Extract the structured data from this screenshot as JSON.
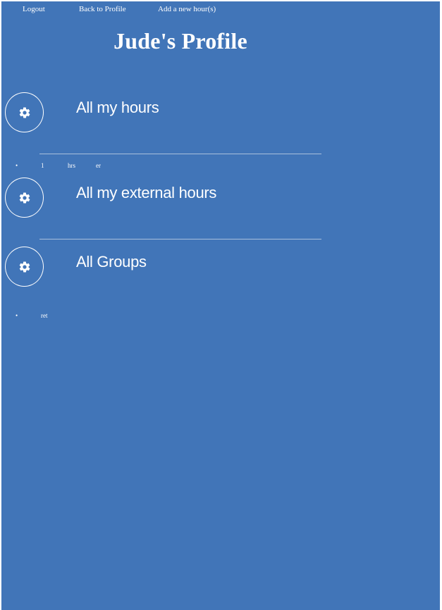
{
  "nav": {
    "logout": "Logout",
    "back_to_profile": "Back to Profile",
    "add_hours": "Add a new hour(s)"
  },
  "page_title": "Jude's Profile",
  "sections": {
    "my_hours": {
      "title": "All my hours",
      "icon": "gear-icon",
      "rows": [
        {
          "bullet": "•",
          "value": "1",
          "unit": "hrs",
          "note": "er"
        }
      ]
    },
    "external_hours": {
      "title": "All my external hours",
      "icon": "gear-icon"
    },
    "groups": {
      "title": "All Groups",
      "icon": "gear-icon",
      "rows": [
        {
          "bullet": "•",
          "name": "ret"
        }
      ]
    }
  },
  "colors": {
    "background": "#4175b8",
    "text": "#ffffff",
    "divider": "#a9bfdc"
  }
}
